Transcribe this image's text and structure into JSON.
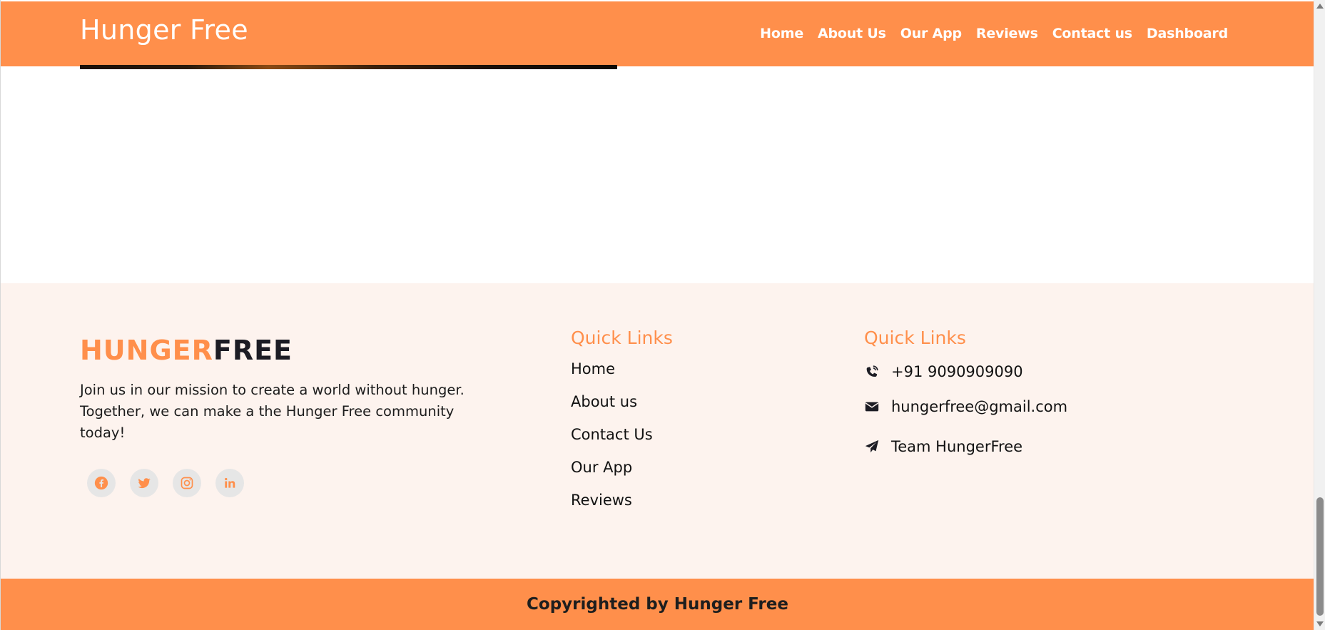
{
  "header": {
    "brand": "Hunger Free",
    "nav": [
      "Home",
      "About Us",
      "Our App",
      "Reviews",
      "Contact us",
      "Dashboard"
    ]
  },
  "footer": {
    "logo_part1": "HUNGER",
    "logo_part2": "FREE",
    "mission": "Join us in our mission to create a world without hunger. Together, we can make a the Hunger Free community today!",
    "socials": [
      {
        "icon": "facebook-icon"
      },
      {
        "icon": "twitter-icon"
      },
      {
        "icon": "instagram-icon"
      },
      {
        "icon": "linkedin-icon"
      }
    ],
    "quick_links_title": "Quick Links",
    "quick_links": [
      "Home",
      "About us",
      "Contact Us",
      "Our App",
      "Reviews"
    ],
    "contact_title": "Quick Links",
    "contacts": [
      {
        "icon": "phone-icon",
        "text": "+91 9090909090"
      },
      {
        "icon": "envelope-icon",
        "text": "hungerfree@gmail.com"
      },
      {
        "icon": "paper-plane-icon",
        "text": "Team HungerFree"
      }
    ]
  },
  "copyright": "Copyrighted by Hunger Free",
  "colors": {
    "accent": "#ff8f4b",
    "footer_bg": "#fdf3ee",
    "dark": "#1c1c24"
  }
}
